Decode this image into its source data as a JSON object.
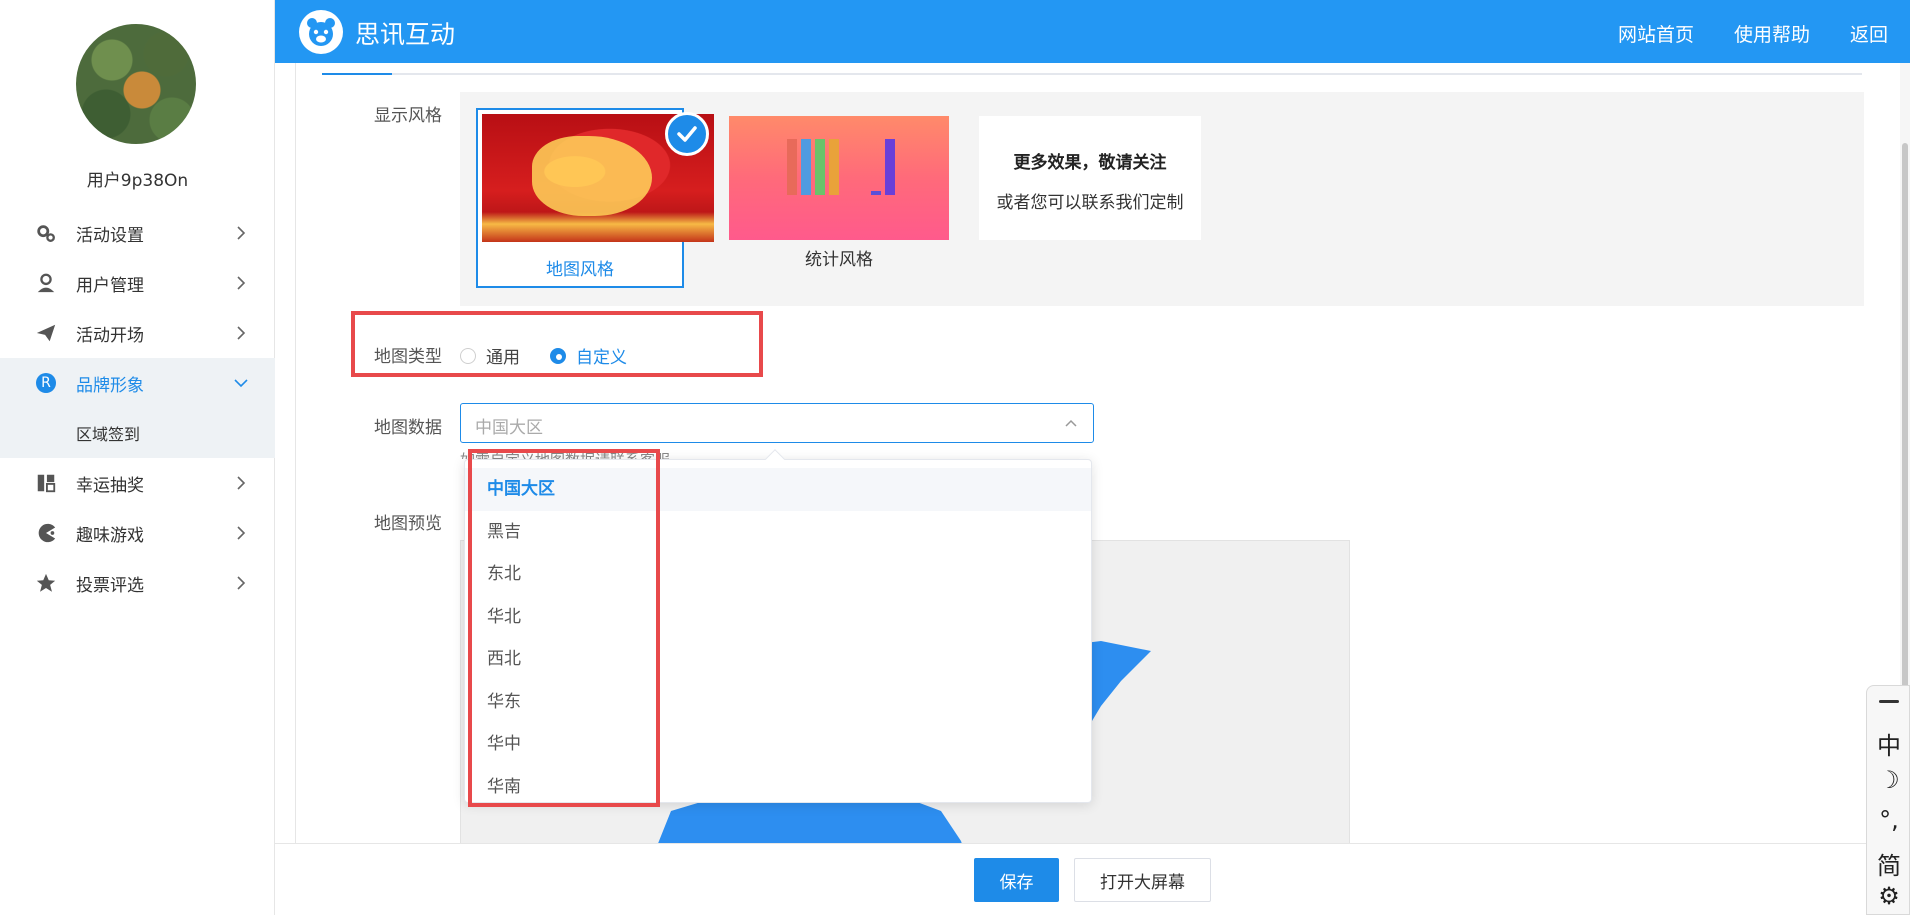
{
  "header": {
    "brand": "思讯互动",
    "nav": [
      "网站首页",
      "使用帮助",
      "返回"
    ]
  },
  "user": {
    "name": "用户9p38On"
  },
  "sidebar": {
    "items": [
      {
        "label": "活动设置",
        "icon": "gear-icon"
      },
      {
        "label": "用户管理",
        "icon": "user-icon"
      },
      {
        "label": "活动开场",
        "icon": "paper-plane-icon"
      },
      {
        "label": "品牌形象",
        "icon": "brand-r-icon",
        "badge": "R"
      },
      {
        "label": "区域签到",
        "icon": ""
      },
      {
        "label": "幸运抽奖",
        "icon": "lottery-icon"
      },
      {
        "label": "趣味游戏",
        "icon": "pacman-icon"
      },
      {
        "label": "投票评选",
        "icon": "star-icon"
      }
    ]
  },
  "form": {
    "display_style_label": "显示风格",
    "styles": {
      "map_label": "地图风格",
      "stat_label": "统计风格",
      "more_title": "更多效果，敬请关注",
      "more_sub": "或者您可以联系我们定制"
    },
    "map_type_label": "地图类型",
    "map_type_options": [
      "通用",
      "自定义"
    ],
    "map_data_label": "地图数据",
    "map_data_value": "中国大区",
    "map_data_helper": "如需自定义地图数据请联系客服",
    "map_preview_label": "地图预览",
    "map_data_options": [
      "中国大区",
      "黑吉",
      "东北",
      "华北",
      "西北",
      "华东",
      "华中",
      "华南"
    ]
  },
  "actions": {
    "save": "保存",
    "open_screen": "打开大屏幕"
  },
  "ime": {
    "chars": [
      "中",
      "☽",
      "°,",
      "简",
      "⚙"
    ]
  },
  "colors": {
    "accent": "#2397f3",
    "highlight": "#e8494b"
  }
}
